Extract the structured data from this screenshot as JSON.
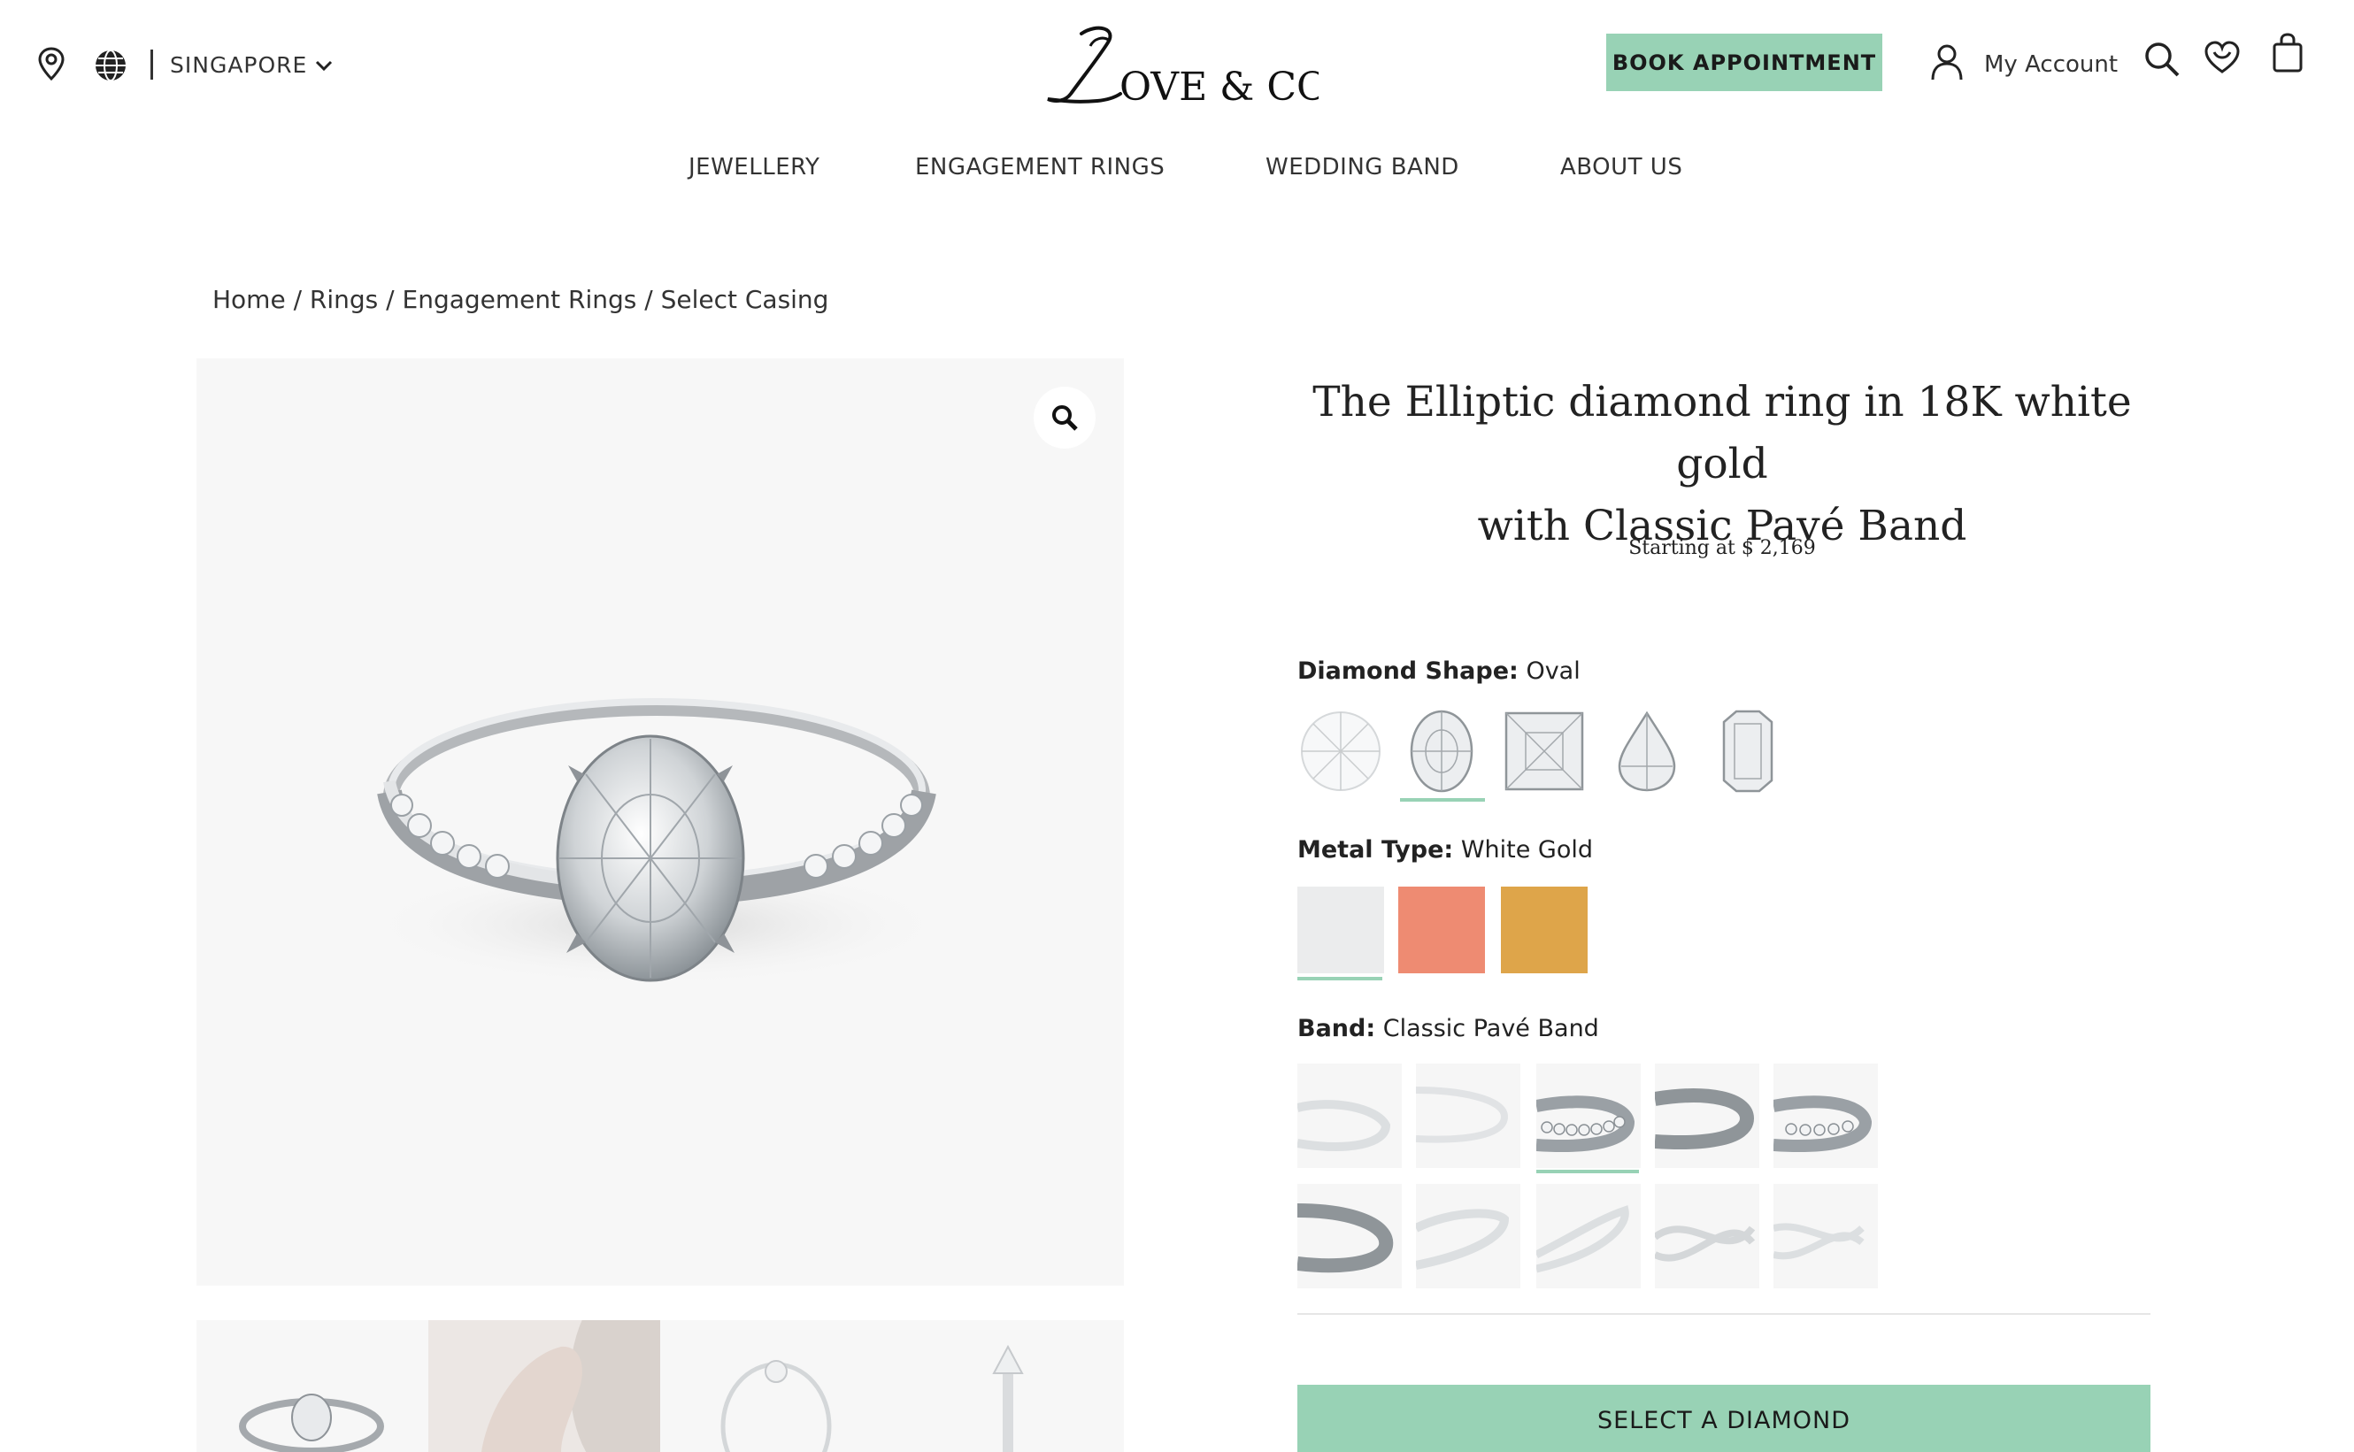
{
  "header": {
    "region": "SINGAPORE",
    "logo_text": "Love & Co.",
    "book_button": "BOOK APPOINTMENT",
    "account_label": "My Account"
  },
  "nav": [
    {
      "label": "JEWELLERY"
    },
    {
      "label": "ENGAGEMENT RINGS"
    },
    {
      "label": "WEDDING BAND"
    },
    {
      "label": "ABOUT US"
    }
  ],
  "breadcrumb": {
    "home": "Home",
    "rings": "Rings",
    "engagement": "Engagement Rings",
    "current": "Select Casing",
    "sep": " / "
  },
  "product": {
    "title_line1": "The Elliptic diamond ring in 18K white gold",
    "title_line2": "with Classic Pavé Band",
    "price": "Starting at $ 2,169"
  },
  "options": {
    "shape": {
      "label": "Diamond Shape:",
      "value": "Oval",
      "items": [
        "round",
        "oval",
        "princess",
        "pear",
        "emerald"
      ],
      "selected": 1
    },
    "metal": {
      "label": "Metal Type:",
      "value": "White Gold",
      "colors": [
        "#ebeced",
        "#ee8b72",
        "#dea54a"
      ],
      "selected": 0
    },
    "band": {
      "label": "Band:",
      "value": "Classic Pavé Band",
      "selected": 2
    }
  },
  "cta": {
    "select_diamond": "SELECT A DIAMOND"
  },
  "colors": {
    "accent": "#98d2b5"
  }
}
